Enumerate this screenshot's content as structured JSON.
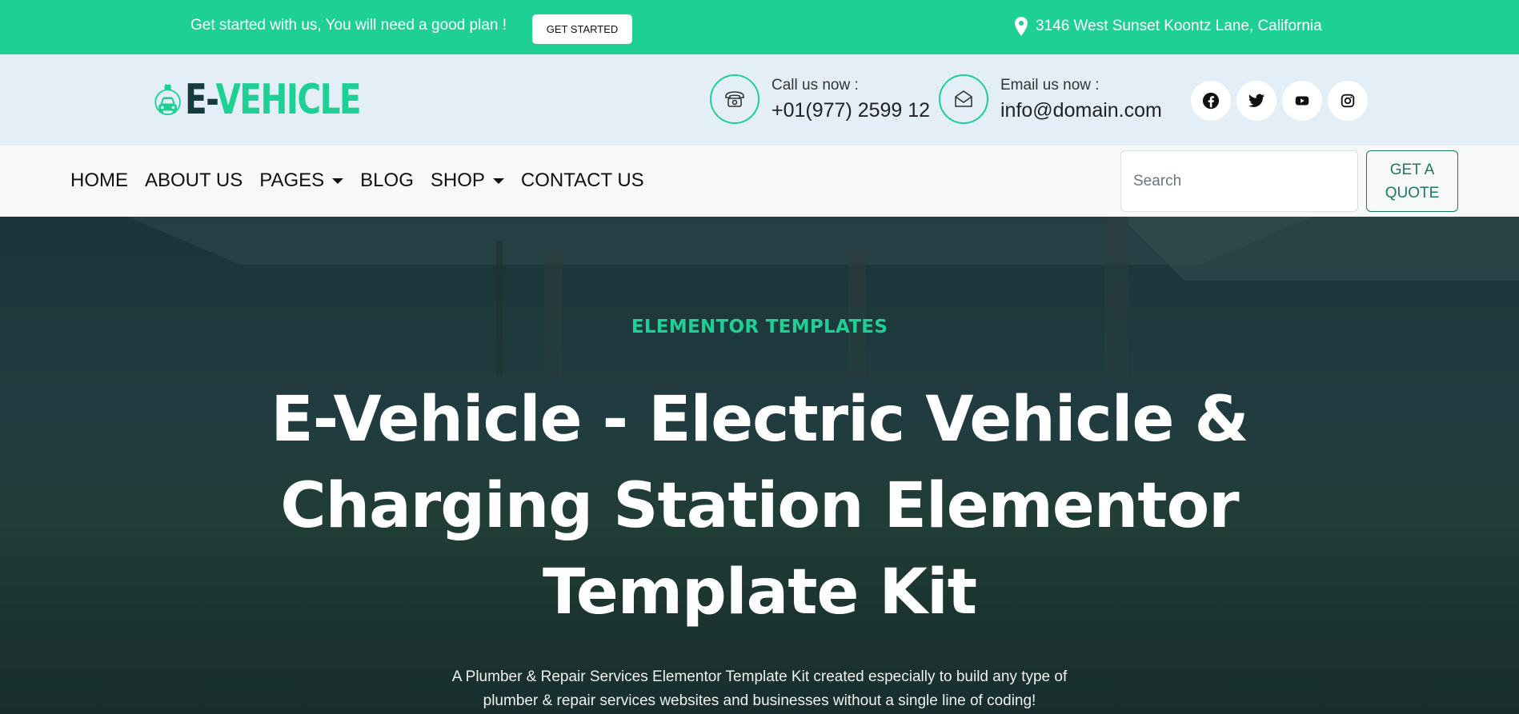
{
  "topbar": {
    "promo": "Get started with us, You will need a good plan !",
    "cta_label": "GET STARTED",
    "address": "3146 West Sunset Koontz Lane, California",
    "address_icon": "map-pin-icon"
  },
  "header": {
    "logo_text_e": "E-",
    "logo_text_rest": "VEHICLE",
    "call": {
      "label": "Call us now :",
      "value": "+01(977) 2599 12",
      "icon": "phone-icon"
    },
    "email": {
      "label": "Email us now :",
      "value": "info@domain.com",
      "icon": "envelope-icon"
    },
    "socials": [
      "facebook-icon",
      "twitter-icon",
      "youtube-icon",
      "instagram-icon"
    ]
  },
  "nav": {
    "items": [
      {
        "label": "HOME",
        "dropdown": false
      },
      {
        "label": "ABOUT US",
        "dropdown": false
      },
      {
        "label": "PAGES",
        "dropdown": true
      },
      {
        "label": "BLOG",
        "dropdown": false
      },
      {
        "label": "SHOP",
        "dropdown": true
      },
      {
        "label": "CONTACT US",
        "dropdown": false
      }
    ],
    "search_placeholder": "Search",
    "quote_line1": "GET A",
    "quote_line2": "QUOTE"
  },
  "hero": {
    "eyebrow": "ELEMENTOR TEMPLATES",
    "title_line1": "E-Vehicle - Electric Vehicle &",
    "title_line2": "Charging Station Elementor",
    "title_line3": "Template Kit",
    "desc_line1": "A Plumber & Repair Services Elementor Template Kit created especially to build any type of",
    "desc_line2": "plumber & repair services websites and businesses without a single line of coding!"
  },
  "colors": {
    "accent": "#1fd094",
    "dark": "#173a3f",
    "header_bg": "#e4eef7",
    "nav_bg": "#f7f8f9",
    "quote_border": "#1a7a5a"
  }
}
